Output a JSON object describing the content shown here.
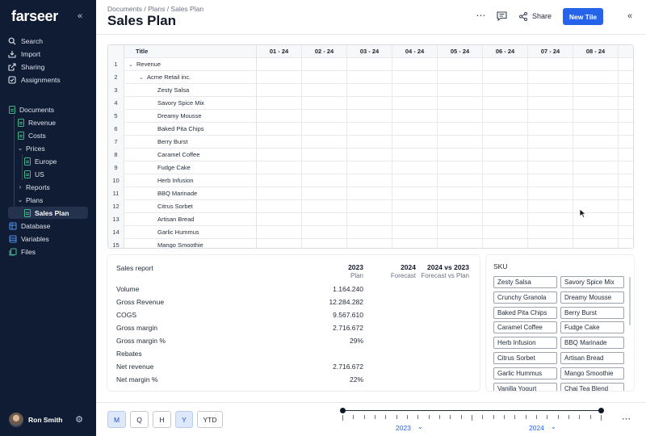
{
  "app": {
    "logo": "farseer"
  },
  "sidebar": {
    "nav": [
      {
        "label": "Search",
        "icon": "search-icon"
      },
      {
        "label": "Import",
        "icon": "import-icon"
      },
      {
        "label": "Sharing",
        "icon": "sharing-icon"
      },
      {
        "label": "Assignments",
        "icon": "assignments-icon"
      }
    ],
    "tree": {
      "documents": "Documents",
      "revenue": "Revenue",
      "costs": "Costs",
      "prices": "Prices",
      "europe": "Europe",
      "us": "US",
      "reports": "Reports",
      "plans": "Plans",
      "sales_plan": "Sales Plan",
      "database": "Database",
      "variables": "Variables",
      "files": "Files"
    },
    "user": {
      "name": "Ron Smith"
    }
  },
  "header": {
    "breadcrumb": "Documents / Plans / Sales Plan",
    "title": "Sales Plan",
    "share_label": "Share",
    "new_tile_label": "New Tile"
  },
  "grid": {
    "title_header": "Title",
    "months": [
      "01 - 24",
      "02 - 24",
      "03 - 24",
      "04 - 24",
      "05 - 24",
      "06 - 24",
      "07 - 24",
      "08 - 24"
    ],
    "rows": [
      {
        "n": "1",
        "label": "Revenue",
        "level": 0,
        "expand": true
      },
      {
        "n": "2",
        "label": "Acme Retail inc.",
        "level": 1,
        "expand": true
      },
      {
        "n": "3",
        "label": "Zesty Salsa",
        "level": 2
      },
      {
        "n": "4",
        "label": "Savory Spice Mix",
        "level": 2
      },
      {
        "n": "5",
        "label": "Dreamy Mousse",
        "level": 2
      },
      {
        "n": "6",
        "label": "Baked Pita Chips",
        "level": 2
      },
      {
        "n": "7",
        "label": "Berry Burst",
        "level": 2
      },
      {
        "n": "8",
        "label": "Caramel Coffee",
        "level": 2
      },
      {
        "n": "9",
        "label": "Fudge Cake",
        "level": 2
      },
      {
        "n": "10",
        "label": "Herb Infusion",
        "level": 2
      },
      {
        "n": "11",
        "label": "BBQ Marinade",
        "level": 2
      },
      {
        "n": "12",
        "label": "Citrus Sorbet",
        "level": 2
      },
      {
        "n": "13",
        "label": "Artisan Bread",
        "level": 2
      },
      {
        "n": "14",
        "label": "Garlic Hummus",
        "level": 2
      },
      {
        "n": "15",
        "label": "Mango Smoothie",
        "level": 2
      }
    ]
  },
  "report": {
    "title": "Sales report",
    "columns": [
      {
        "year": "2023",
        "sub": "Plan"
      },
      {
        "year": "2024",
        "sub": "Forecast"
      },
      {
        "year": "2024 vs 2023",
        "sub": "Forecast vs Plan"
      }
    ],
    "rows": [
      {
        "label": "Volume",
        "value": "1.164.240"
      },
      {
        "label": "Gross Revenue",
        "value": "12.284.282"
      },
      {
        "label": "COGS",
        "value": "9.567.610"
      },
      {
        "label": "Gross margin",
        "value": "2.716.672"
      },
      {
        "label": "Gross margin %",
        "value": "29%"
      },
      {
        "label": "Rebates",
        "value": ""
      },
      {
        "label": "Net revenue",
        "value": "2.716.672"
      },
      {
        "label": "Net margin %",
        "value": "22%"
      }
    ]
  },
  "sku": {
    "title": "SKU",
    "items": [
      "Zesty Salsa",
      "Savory Spice Mix",
      "Crunchy Granola",
      "Dreamy Mousse",
      "Baked Pita Chips",
      "Berry Burst",
      "Caramel Coffee",
      "Fudge Cake",
      "Herb Infusion",
      "BBQ Marinade",
      "Citrus Sorbet",
      "Artisan Bread",
      "Garlic Hummus",
      "Mango Smoothie",
      "Vanilla Yogurt",
      "Chai Tea Blend"
    ]
  },
  "bottom": {
    "periods": [
      {
        "label": "M",
        "active": true
      },
      {
        "label": "Q",
        "active": false
      },
      {
        "label": "H",
        "active": false
      },
      {
        "label": "Y",
        "active": true
      },
      {
        "label": "YTD",
        "active": false
      }
    ],
    "timeline": {
      "start_year": "2023",
      "end_year": "2024"
    }
  },
  "colors": {
    "accent": "#2563eb",
    "sidebar_bg": "#0f1c33",
    "doc_icon": "#3fb68b"
  }
}
